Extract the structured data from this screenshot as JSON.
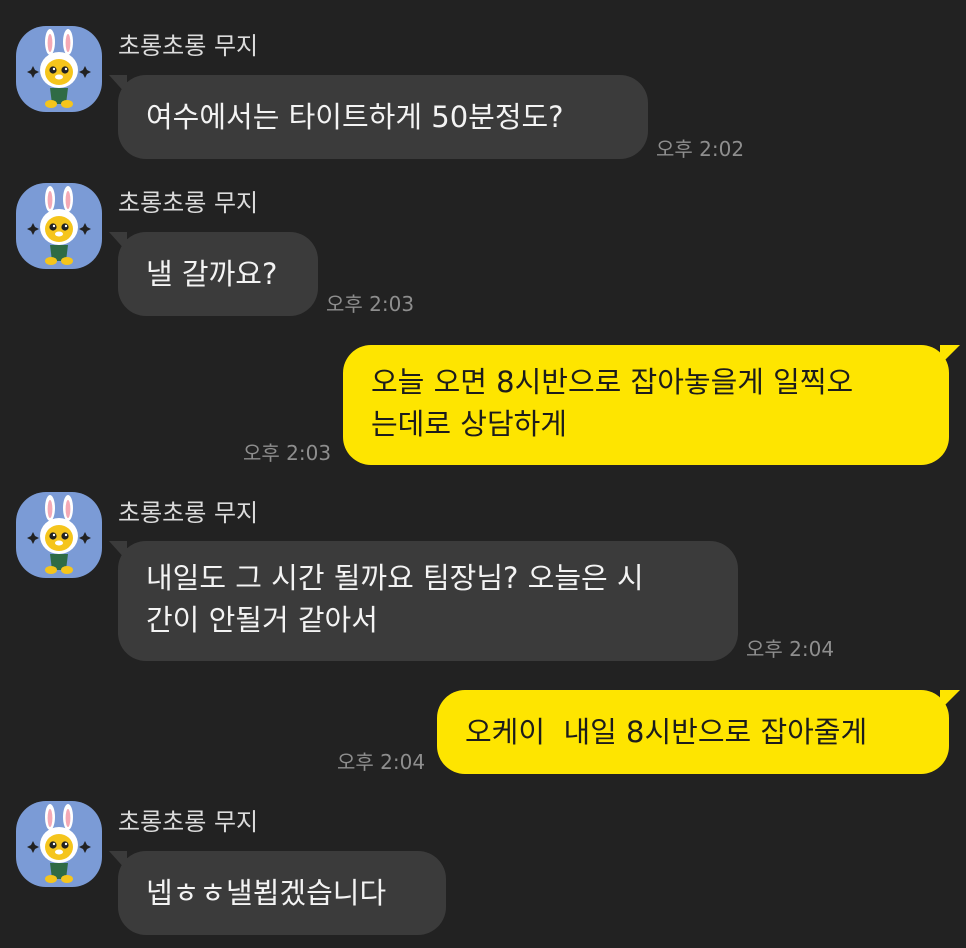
{
  "messages": [
    {
      "direction": "in",
      "sender": "초롱초롱 무지",
      "text": "여수에서는 타이트하게 50분정도?",
      "time": "오후 2:02"
    },
    {
      "direction": "in",
      "sender": "초롱초롱 무지",
      "text": "낼 갈까요?",
      "time": "오후 2:03"
    },
    {
      "direction": "out",
      "lines": [
        "오늘 오면 8시반으로 잡아놓을게 일찍오",
        "는데로 상담하게"
      ],
      "time": "오후 2:03"
    },
    {
      "direction": "in",
      "sender": "초롱초롱 무지",
      "lines": [
        "내일도 그 시간 될까요 팀장님? 오늘은 시",
        "간이 안될거 같아서"
      ],
      "time": "오후 2:04"
    },
    {
      "direction": "out",
      "text": "오케이  내일 8시반으로 잡아줄게",
      "time": "오후 2:04"
    },
    {
      "direction": "in",
      "sender": "초롱초롱 무지",
      "text": "넵ㅎㅎ낼뵙겠습니다"
    }
  ],
  "colors": {
    "background": "#222222",
    "incoming_bubble": "#3b3b3b",
    "outgoing_bubble": "#fee500",
    "avatar_bg": "#7b9bd6"
  },
  "icons": {
    "avatar": "muzi-bunny-avatar-icon"
  }
}
